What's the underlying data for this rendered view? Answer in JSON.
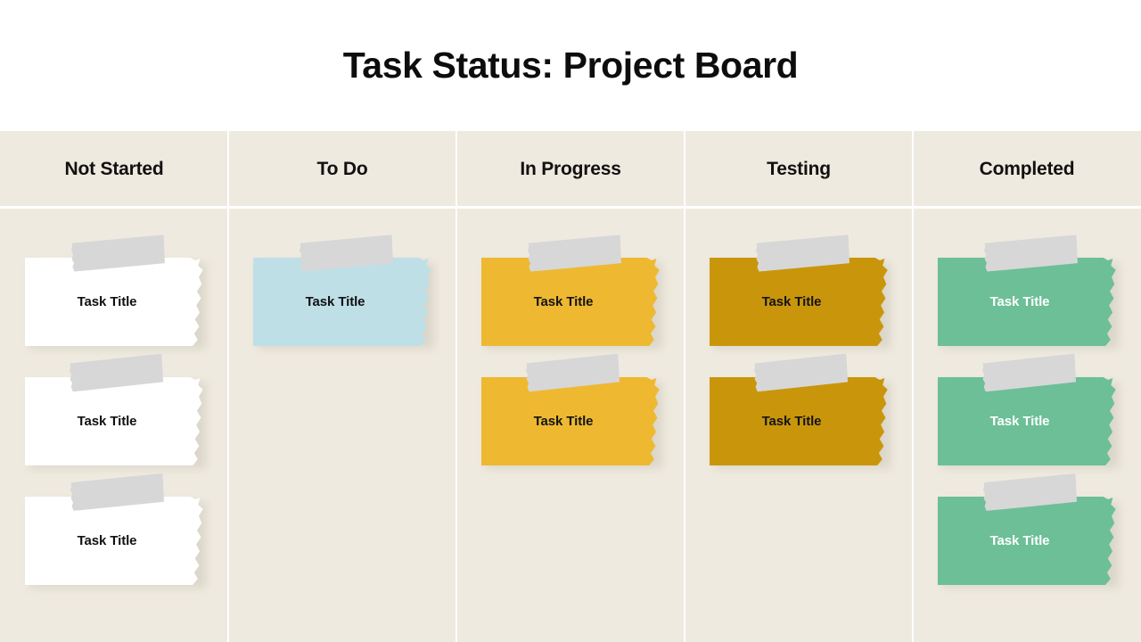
{
  "slide": {
    "title": "Task Status: Project Board",
    "background_color": "#FFFFFF",
    "board_background_color": "#F0EBE0",
    "divider_color": "#FFFFFF",
    "tape_color": "#D7D7D7"
  },
  "board": {
    "columns": [
      {
        "id": "not-started",
        "header": "Not Started",
        "card_color": "#FFFFFF",
        "card_text_color": "#111111",
        "cards": [
          {
            "title": "Task Title"
          },
          {
            "title": "Task Title"
          },
          {
            "title": "Task Title"
          }
        ]
      },
      {
        "id": "to-do",
        "header": "To Do",
        "card_color": "#BFDFE7",
        "card_text_color": "#111111",
        "cards": [
          {
            "title": "Task Title"
          }
        ]
      },
      {
        "id": "in-progress",
        "header": "In Progress",
        "card_color": "#EEB931",
        "card_text_color": "#141414",
        "cards": [
          {
            "title": "Task Title"
          },
          {
            "title": "Task Title"
          }
        ]
      },
      {
        "id": "testing",
        "header": "Testing",
        "card_color": "#C9960B",
        "card_text_color": "#141414",
        "cards": [
          {
            "title": "Task Title"
          },
          {
            "title": "Task Title"
          }
        ]
      },
      {
        "id": "completed",
        "header": "Completed",
        "card_color": "#6CBF97",
        "card_text_color": "#FFFFFF",
        "cards": [
          {
            "title": "Task Title"
          },
          {
            "title": "Task Title"
          },
          {
            "title": "Task Title"
          }
        ]
      }
    ]
  }
}
